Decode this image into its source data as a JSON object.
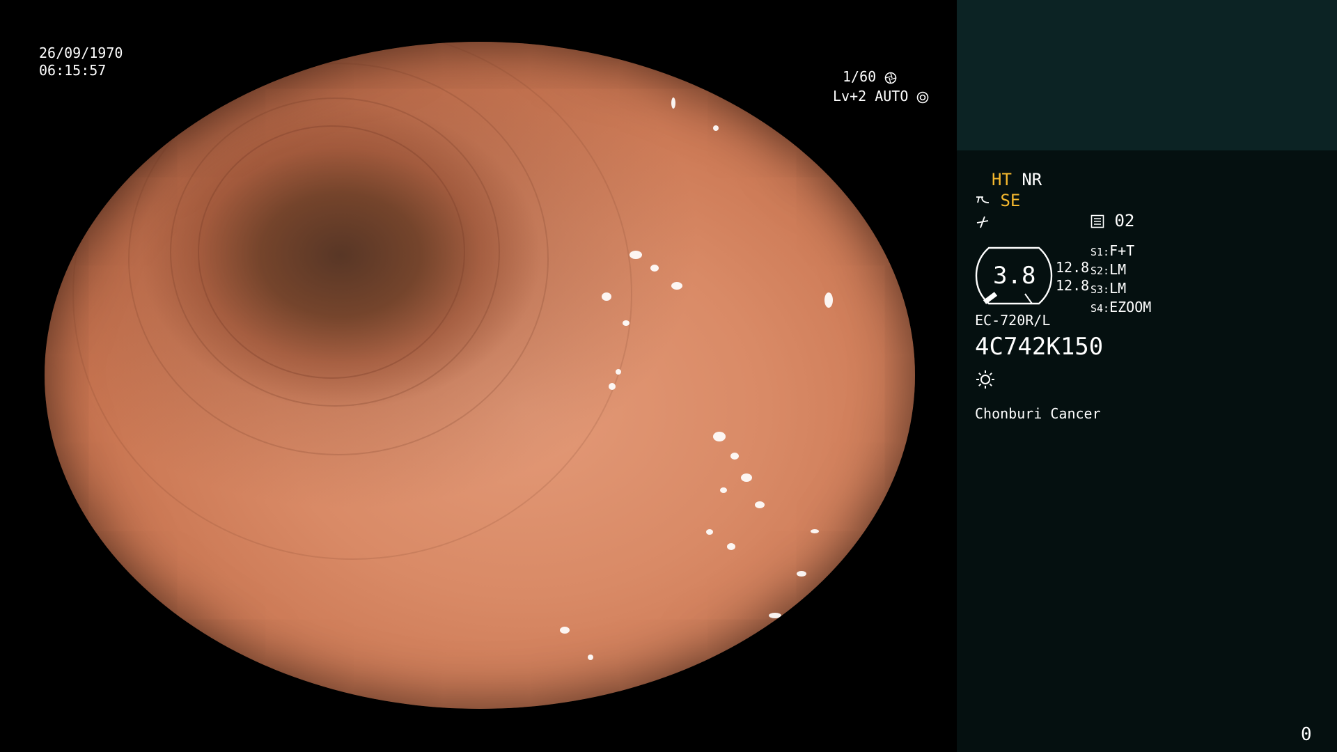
{
  "overlay": {
    "date": "26/09/1970",
    "time": "06:15:57",
    "shutter": "1/60",
    "level": "Lv+2",
    "exposure_mode": "AUTO"
  },
  "sidebar": {
    "ht": "HT",
    "nr": "NR",
    "se": "SE",
    "memory_number": "02",
    "gauge_value": "3.8",
    "gauge_left_top": "12.8",
    "gauge_left_bottom": "12.8",
    "switches": [
      {
        "label": "S1:",
        "value": "F+T"
      },
      {
        "label": "S2:",
        "value": "LM"
      },
      {
        "label": "S3:",
        "value": "LM"
      },
      {
        "label": "S4:",
        "value": "EZOOM"
      }
    ],
    "scope_model": "EC-720R/L",
    "serial": "4C742K150",
    "institution": "Chonburi Cancer",
    "counter": "0"
  },
  "icons": {
    "shutter_icon": "aperture-icon",
    "auto_icon": "iris-icon",
    "enhance_icon": "structure-enhance-icon",
    "color_icon": "color-icon",
    "memory_icon": "memory-icon",
    "light_icon": "light-icon"
  }
}
